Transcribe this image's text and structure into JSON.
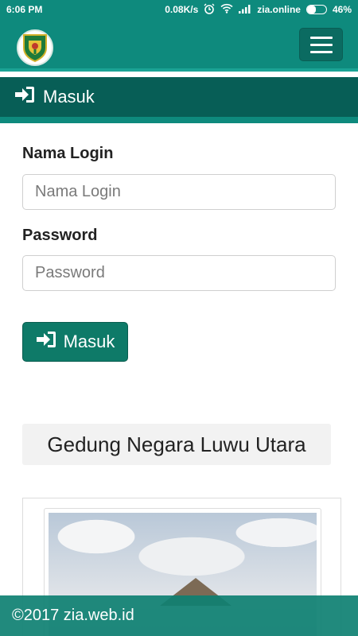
{
  "status_bar": {
    "time": "6:06 PM",
    "speed": "0.08K/s",
    "carrier": "zia.online",
    "battery": "46%",
    "battery_level": 0.46
  },
  "navbar": {
    "logo_icon": "regency-emblem-icon",
    "menu_icon": "hamburger-menu-icon"
  },
  "panel": {
    "title": "Masuk",
    "icon": "sign-in-icon"
  },
  "form": {
    "username_label": "Nama Login",
    "username_placeholder": "Nama Login",
    "username_value": "",
    "password_label": "Password",
    "password_placeholder": "Password",
    "password_value": "",
    "submit_label": "Masuk"
  },
  "gallery": {
    "title": "Gedung Negara Luwu Utara"
  },
  "footer": {
    "text": "©2017 zia.web.id"
  },
  "colors": {
    "primary": "#0e8a7d",
    "primary_dark": "#075e56",
    "button": "#0e7a68"
  }
}
